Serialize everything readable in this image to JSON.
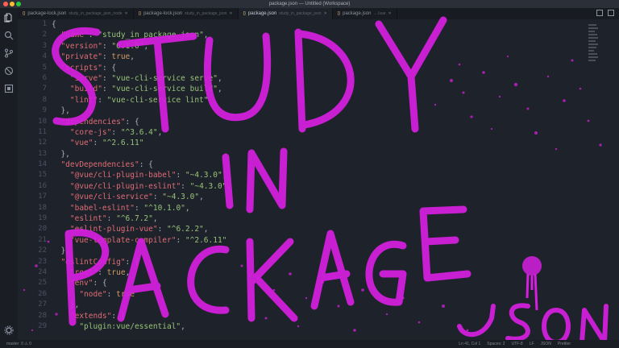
{
  "window": {
    "title": "package.json — Untitled (Workspace)"
  },
  "tabs": [
    {
      "name": "package-lock.json",
      "desc": "study_in_package_json_node",
      "active": false
    },
    {
      "name": "package-lock.json",
      "desc": "study_in_package_json",
      "active": false
    },
    {
      "name": "package.json",
      "desc": "study_in_package_json",
      "active": true
    },
    {
      "name": "package.json",
      "desc": "..../vue",
      "active": false
    }
  ],
  "editor": {
    "line_numbers": [
      "1",
      "2",
      "3",
      "4",
      "5",
      "6",
      "7",
      "8",
      "9",
      "10",
      "11",
      "12",
      "13",
      "14",
      "15",
      "16",
      "17",
      "18",
      "19",
      "20",
      "21",
      "22",
      "23",
      "24",
      "25",
      "26",
      "27",
      "28",
      "29"
    ],
    "lines": [
      [
        {
          "t": "{",
          "c": "p"
        }
      ],
      [
        {
          "t": "  ",
          "c": "p"
        },
        {
          "t": "\"name\"",
          "c": "k"
        },
        {
          "t": ": ",
          "c": "p"
        },
        {
          "t": "\"study_in_package_json\"",
          "c": "s"
        },
        {
          "t": ",",
          "c": "p"
        }
      ],
      [
        {
          "t": "  ",
          "c": "p"
        },
        {
          "t": "\"version\"",
          "c": "k"
        },
        {
          "t": ": ",
          "c": "p"
        },
        {
          "t": "\"0.1.0\"",
          "c": "s"
        },
        {
          "t": ",",
          "c": "p"
        }
      ],
      [
        {
          "t": "  ",
          "c": "p"
        },
        {
          "t": "\"private\"",
          "c": "k"
        },
        {
          "t": ": ",
          "c": "p"
        },
        {
          "t": "true",
          "c": "b"
        },
        {
          "t": ",",
          "c": "p"
        }
      ],
      [
        {
          "t": "  ",
          "c": "p"
        },
        {
          "t": "\"scripts\"",
          "c": "k"
        },
        {
          "t": ": {",
          "c": "p"
        }
      ],
      [
        {
          "t": "    ",
          "c": "p"
        },
        {
          "t": "\"serve\"",
          "c": "k"
        },
        {
          "t": ": ",
          "c": "p"
        },
        {
          "t": "\"vue-cli-service serve\"",
          "c": "s"
        },
        {
          "t": ",",
          "c": "p"
        }
      ],
      [
        {
          "t": "    ",
          "c": "p"
        },
        {
          "t": "\"build\"",
          "c": "k"
        },
        {
          "t": ": ",
          "c": "p"
        },
        {
          "t": "\"vue-cli-service build\"",
          "c": "s"
        },
        {
          "t": ",",
          "c": "p"
        }
      ],
      [
        {
          "t": "    ",
          "c": "p"
        },
        {
          "t": "\"lint\"",
          "c": "k"
        },
        {
          "t": ": ",
          "c": "p"
        },
        {
          "t": "\"vue-cli-service lint\"",
          "c": "s"
        }
      ],
      [
        {
          "t": "  },",
          "c": "p"
        }
      ],
      [
        {
          "t": "  ",
          "c": "p"
        },
        {
          "t": "\"dependencies\"",
          "c": "k"
        },
        {
          "t": ": {",
          "c": "p"
        }
      ],
      [
        {
          "t": "    ",
          "c": "p"
        },
        {
          "t": "\"core-js\"",
          "c": "k"
        },
        {
          "t": ": ",
          "c": "p"
        },
        {
          "t": "\"^3.6.4\"",
          "c": "s"
        },
        {
          "t": ",",
          "c": "p"
        }
      ],
      [
        {
          "t": "    ",
          "c": "p"
        },
        {
          "t": "\"vue\"",
          "c": "k"
        },
        {
          "t": ": ",
          "c": "p"
        },
        {
          "t": "\"^2.6.11\"",
          "c": "s"
        }
      ],
      [
        {
          "t": "  },",
          "c": "p"
        }
      ],
      [
        {
          "t": "  ",
          "c": "p"
        },
        {
          "t": "\"devDependencies\"",
          "c": "k"
        },
        {
          "t": ": {",
          "c": "p"
        }
      ],
      [
        {
          "t": "    ",
          "c": "p"
        },
        {
          "t": "\"@vue/cli-plugin-babel\"",
          "c": "k"
        },
        {
          "t": ": ",
          "c": "p"
        },
        {
          "t": "\"~4.3.0\"",
          "c": "s"
        },
        {
          "t": ",",
          "c": "p"
        }
      ],
      [
        {
          "t": "    ",
          "c": "p"
        },
        {
          "t": "\"@vue/cli-plugin-eslint\"",
          "c": "k"
        },
        {
          "t": ": ",
          "c": "p"
        },
        {
          "t": "\"~4.3.0\"",
          "c": "s"
        },
        {
          "t": ",",
          "c": "p"
        }
      ],
      [
        {
          "t": "    ",
          "c": "p"
        },
        {
          "t": "\"@vue/cli-service\"",
          "c": "k"
        },
        {
          "t": ": ",
          "c": "p"
        },
        {
          "t": "\"~4.3.0\"",
          "c": "s"
        },
        {
          "t": ",",
          "c": "p"
        }
      ],
      [
        {
          "t": "    ",
          "c": "p"
        },
        {
          "t": "\"babel-eslint\"",
          "c": "k"
        },
        {
          "t": ": ",
          "c": "p"
        },
        {
          "t": "\"^10.1.0\"",
          "c": "s"
        },
        {
          "t": ",",
          "c": "p"
        }
      ],
      [
        {
          "t": "    ",
          "c": "p"
        },
        {
          "t": "\"eslint\"",
          "c": "k"
        },
        {
          "t": ": ",
          "c": "p"
        },
        {
          "t": "\"^6.7.2\"",
          "c": "s"
        },
        {
          "t": ",",
          "c": "p"
        }
      ],
      [
        {
          "t": "    ",
          "c": "p"
        },
        {
          "t": "\"eslint-plugin-vue\"",
          "c": "k"
        },
        {
          "t": ": ",
          "c": "p"
        },
        {
          "t": "\"^6.2.2\"",
          "c": "s"
        },
        {
          "t": ",",
          "c": "p"
        }
      ],
      [
        {
          "t": "    ",
          "c": "p"
        },
        {
          "t": "\"vue-template-compiler\"",
          "c": "k"
        },
        {
          "t": ": ",
          "c": "p"
        },
        {
          "t": "\"^2.6.11\"",
          "c": "s"
        }
      ],
      [
        {
          "t": "  },",
          "c": "p"
        }
      ],
      [
        {
          "t": "  ",
          "c": "p"
        },
        {
          "t": "\"eslintConfig\"",
          "c": "k"
        },
        {
          "t": ": {",
          "c": "p"
        }
      ],
      [
        {
          "t": "    ",
          "c": "p"
        },
        {
          "t": "\"root\"",
          "c": "k"
        },
        {
          "t": ": ",
          "c": "p"
        },
        {
          "t": "true",
          "c": "b"
        },
        {
          "t": ",",
          "c": "p"
        }
      ],
      [
        {
          "t": "    ",
          "c": "p"
        },
        {
          "t": "\"env\"",
          "c": "k"
        },
        {
          "t": ": {",
          "c": "p"
        }
      ],
      [
        {
          "t": "      ",
          "c": "p"
        },
        {
          "t": "\"node\"",
          "c": "k"
        },
        {
          "t": ": ",
          "c": "p"
        },
        {
          "t": "true",
          "c": "b"
        }
      ],
      [
        {
          "t": "    },",
          "c": "p"
        }
      ],
      [
        {
          "t": "    ",
          "c": "p"
        },
        {
          "t": "\"extends\"",
          "c": "k"
        },
        {
          "t": ": [",
          "c": "p"
        }
      ],
      [
        {
          "t": "      ",
          "c": "p"
        },
        {
          "t": "\"plugin:vue/essential\"",
          "c": "s"
        },
        {
          "t": ",",
          "c": "p"
        }
      ]
    ]
  },
  "graffiti": {
    "line1": "STUDY",
    "line2": "IN",
    "line3": "PACKAGE",
    "line4": "JSON",
    "color": "#d61fe0"
  },
  "statusbar": {
    "branch": "master",
    "problems": "0 ⚠ 0",
    "position": "Ln 41, Col 1",
    "spaces": "Spaces: 2",
    "encoding": "UTF-8",
    "eol": "LF",
    "language": "JSON",
    "formatter": "Prettier"
  },
  "colors": {
    "background": "#1e222b",
    "key": "#e06c75",
    "string": "#98c379",
    "boolean": "#d19a66",
    "graffiti": "#d61fe0"
  }
}
